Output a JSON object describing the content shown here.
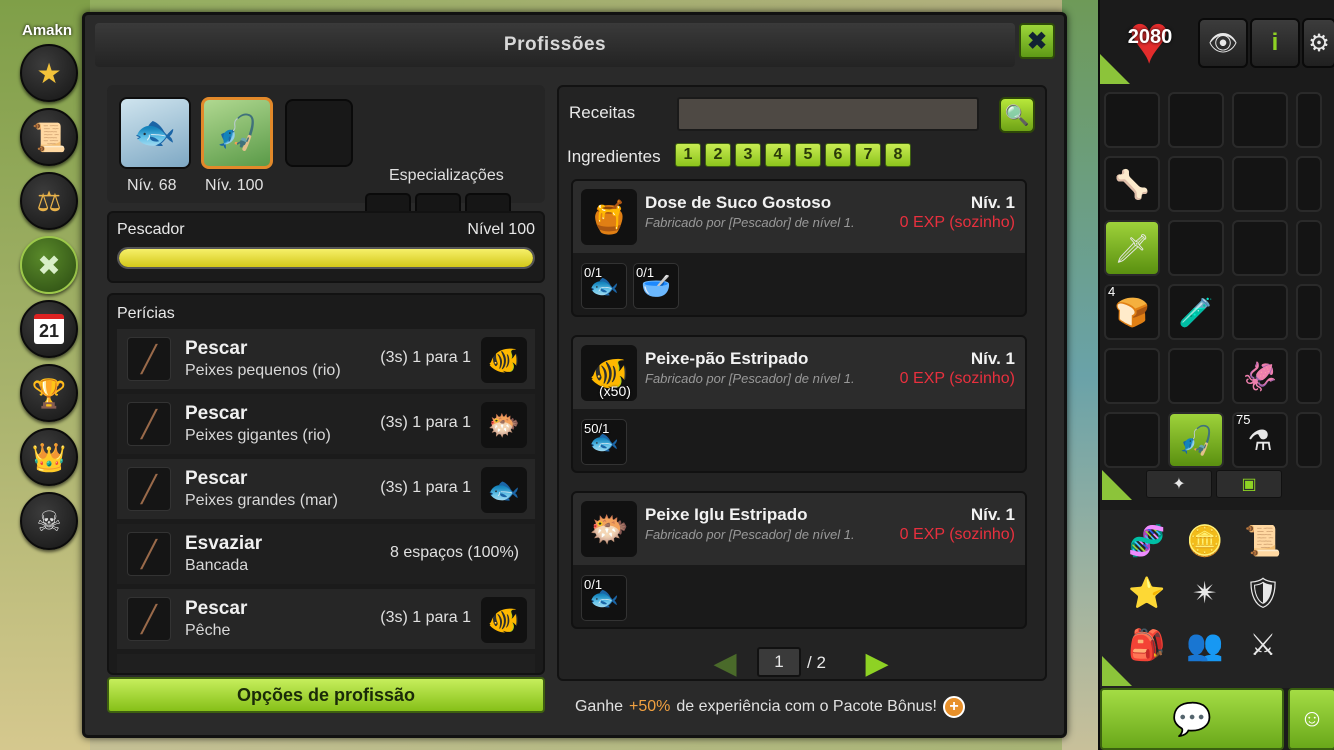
{
  "background": {
    "corner_text": "Amakn"
  },
  "left_nav": [
    {
      "icon": "star-wand-icon",
      "glyph": "★"
    },
    {
      "icon": "scroll-icon",
      "glyph": "📜"
    },
    {
      "icon": "scales-icon",
      "glyph": "⚖"
    },
    {
      "icon": "crossed-tools-icon",
      "glyph": "✖"
    },
    {
      "icon": "calendar-icon",
      "glyph": "21"
    },
    {
      "icon": "trophy-icon",
      "glyph": "🏆"
    },
    {
      "icon": "crown-icon",
      "glyph": "👑"
    },
    {
      "icon": "horned-helmet-icon",
      "glyph": "☠"
    }
  ],
  "window": {
    "title": "Profissões",
    "close_label": "✖"
  },
  "professions": {
    "items": [
      {
        "level": "Nív. 68",
        "icon": "fish-icon",
        "glyph": "🐟"
      },
      {
        "level": "Nív. 100",
        "icon": "fishing-rod-icon",
        "glyph": "🎣"
      }
    ],
    "specializations_title": "Especializações"
  },
  "xp": {
    "name": "Pescador",
    "level": "Nível 100",
    "progress": 1.0
  },
  "skills": {
    "title": "Perícias",
    "rows": [
      {
        "name": "Pescar",
        "sub": "Peixes pequenos (rio)",
        "info": "(3s) 1 para 1",
        "res_glyph": "🐠"
      },
      {
        "name": "Pescar",
        "sub": "Peixes gigantes (rio)",
        "info": "(3s) 1 para 1",
        "res_glyph": "🐡"
      },
      {
        "name": "Pescar",
        "sub": "Peixes grandes (mar)",
        "info": "(3s) 1 para 1",
        "res_glyph": "🐟"
      },
      {
        "name": "Esvaziar",
        "sub": "Bancada",
        "info": "8 espaços (100%)",
        "res_glyph": ""
      },
      {
        "name": "Pescar",
        "sub": "Pêche",
        "info": "(3s) 1 para 1",
        "res_glyph": "🐠"
      }
    ]
  },
  "options_button": "Opções de profissão",
  "recipes": {
    "label": "Receitas",
    "search_value": "",
    "ingredients_label": "Ingredientes",
    "ingredient_filters": [
      "1",
      "2",
      "3",
      "4",
      "5",
      "6",
      "7",
      "8"
    ],
    "list": [
      {
        "name": "Dose de Suco Gostoso",
        "by": "Fabricado por [Pescador] de nível 1.",
        "level": "Nív. 1",
        "exp": "0 EXP (sozinho)",
        "qty": "",
        "glyph": "🍯",
        "ingredients": [
          {
            "count": "0/1",
            "glyph": "🐟"
          },
          {
            "count": "0/1",
            "glyph": "🥣"
          }
        ]
      },
      {
        "name": "Peixe-pão Estripado",
        "by": "Fabricado por [Pescador] de nível 1.",
        "level": "Nív. 1",
        "exp": "0 EXP (sozinho)",
        "qty": "(x50)",
        "glyph": "🐠",
        "ingredients": [
          {
            "count": "50/1",
            "glyph": "🐟"
          }
        ]
      },
      {
        "name": "Peixe Iglu Estripado",
        "by": "Fabricado por [Pescador] de nível 1.",
        "level": "Nív. 1",
        "exp": "0 EXP (sozinho)",
        "qty": "",
        "glyph": "🐡",
        "ingredients": [
          {
            "count": "0/1",
            "glyph": "🐟"
          }
        ]
      }
    ],
    "page_current": "1",
    "page_total": "/ 2"
  },
  "bonus": {
    "prefix": "Ganhe",
    "highlight": "+50%",
    "suffix": "de experiência com o Pacote Bônus!"
  },
  "hud": {
    "hp": "2080",
    "buttons": [
      {
        "icon": "eye-icon",
        "glyph": "👁"
      },
      {
        "icon": "info-icon",
        "glyph": "i"
      },
      {
        "icon": "settings-icon",
        "glyph": "⚙"
      }
    ],
    "inventory": [
      {
        "glyph": "",
        "count": ""
      },
      {
        "glyph": "",
        "count": ""
      },
      {
        "glyph": "",
        "count": ""
      },
      {
        "glyph": "🦴",
        "count": ""
      },
      {
        "glyph": "",
        "count": ""
      },
      {
        "glyph": "",
        "count": ""
      },
      {
        "glyph": "🗡",
        "count": "",
        "sel": true
      },
      {
        "glyph": "",
        "count": ""
      },
      {
        "glyph": "",
        "count": ""
      },
      {
        "glyph": "🍞",
        "count": "4"
      },
      {
        "glyph": "🧪",
        "count": ""
      },
      {
        "glyph": "",
        "count": ""
      },
      {
        "glyph": "",
        "count": ""
      },
      {
        "glyph": "",
        "count": ""
      },
      {
        "glyph": "🦑",
        "count": ""
      },
      {
        "glyph": "",
        "count": ""
      },
      {
        "glyph": "🎣",
        "count": "",
        "sel": true
      },
      {
        "glyph": "⚗",
        "count": "75"
      }
    ],
    "shortcuts": [
      "🧬",
      "🪙",
      "📜",
      "⭐",
      "✴",
      "🛡",
      "🎒",
      "👥",
      "⚔"
    ]
  }
}
